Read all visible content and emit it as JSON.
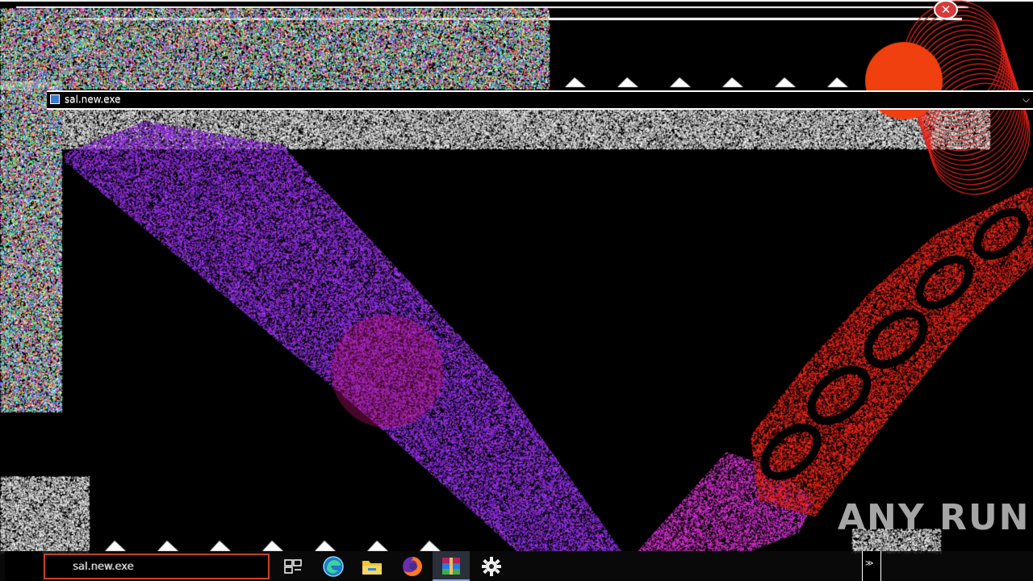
{
  "window": {
    "title": "sal.new.exe",
    "close_glyph": "✕",
    "chevron_glyph": "⌵"
  },
  "taskbar": {
    "search_text": "sal.new.exe",
    "icons": [
      "task-view-icon",
      "edge-icon",
      "file-explorer-icon",
      "firefox-icon",
      "winrar-icon",
      "settings-gear-icon"
    ],
    "tray_text": "≫"
  },
  "watermark": {
    "text": "ANY RUN"
  },
  "colors": {
    "purple_stroke": "#8a2be2",
    "magenta_stroke": "#d020c0",
    "red_chain": "#e8231a",
    "orange_circle": "#f04010",
    "noise": "#d0d0d0"
  }
}
